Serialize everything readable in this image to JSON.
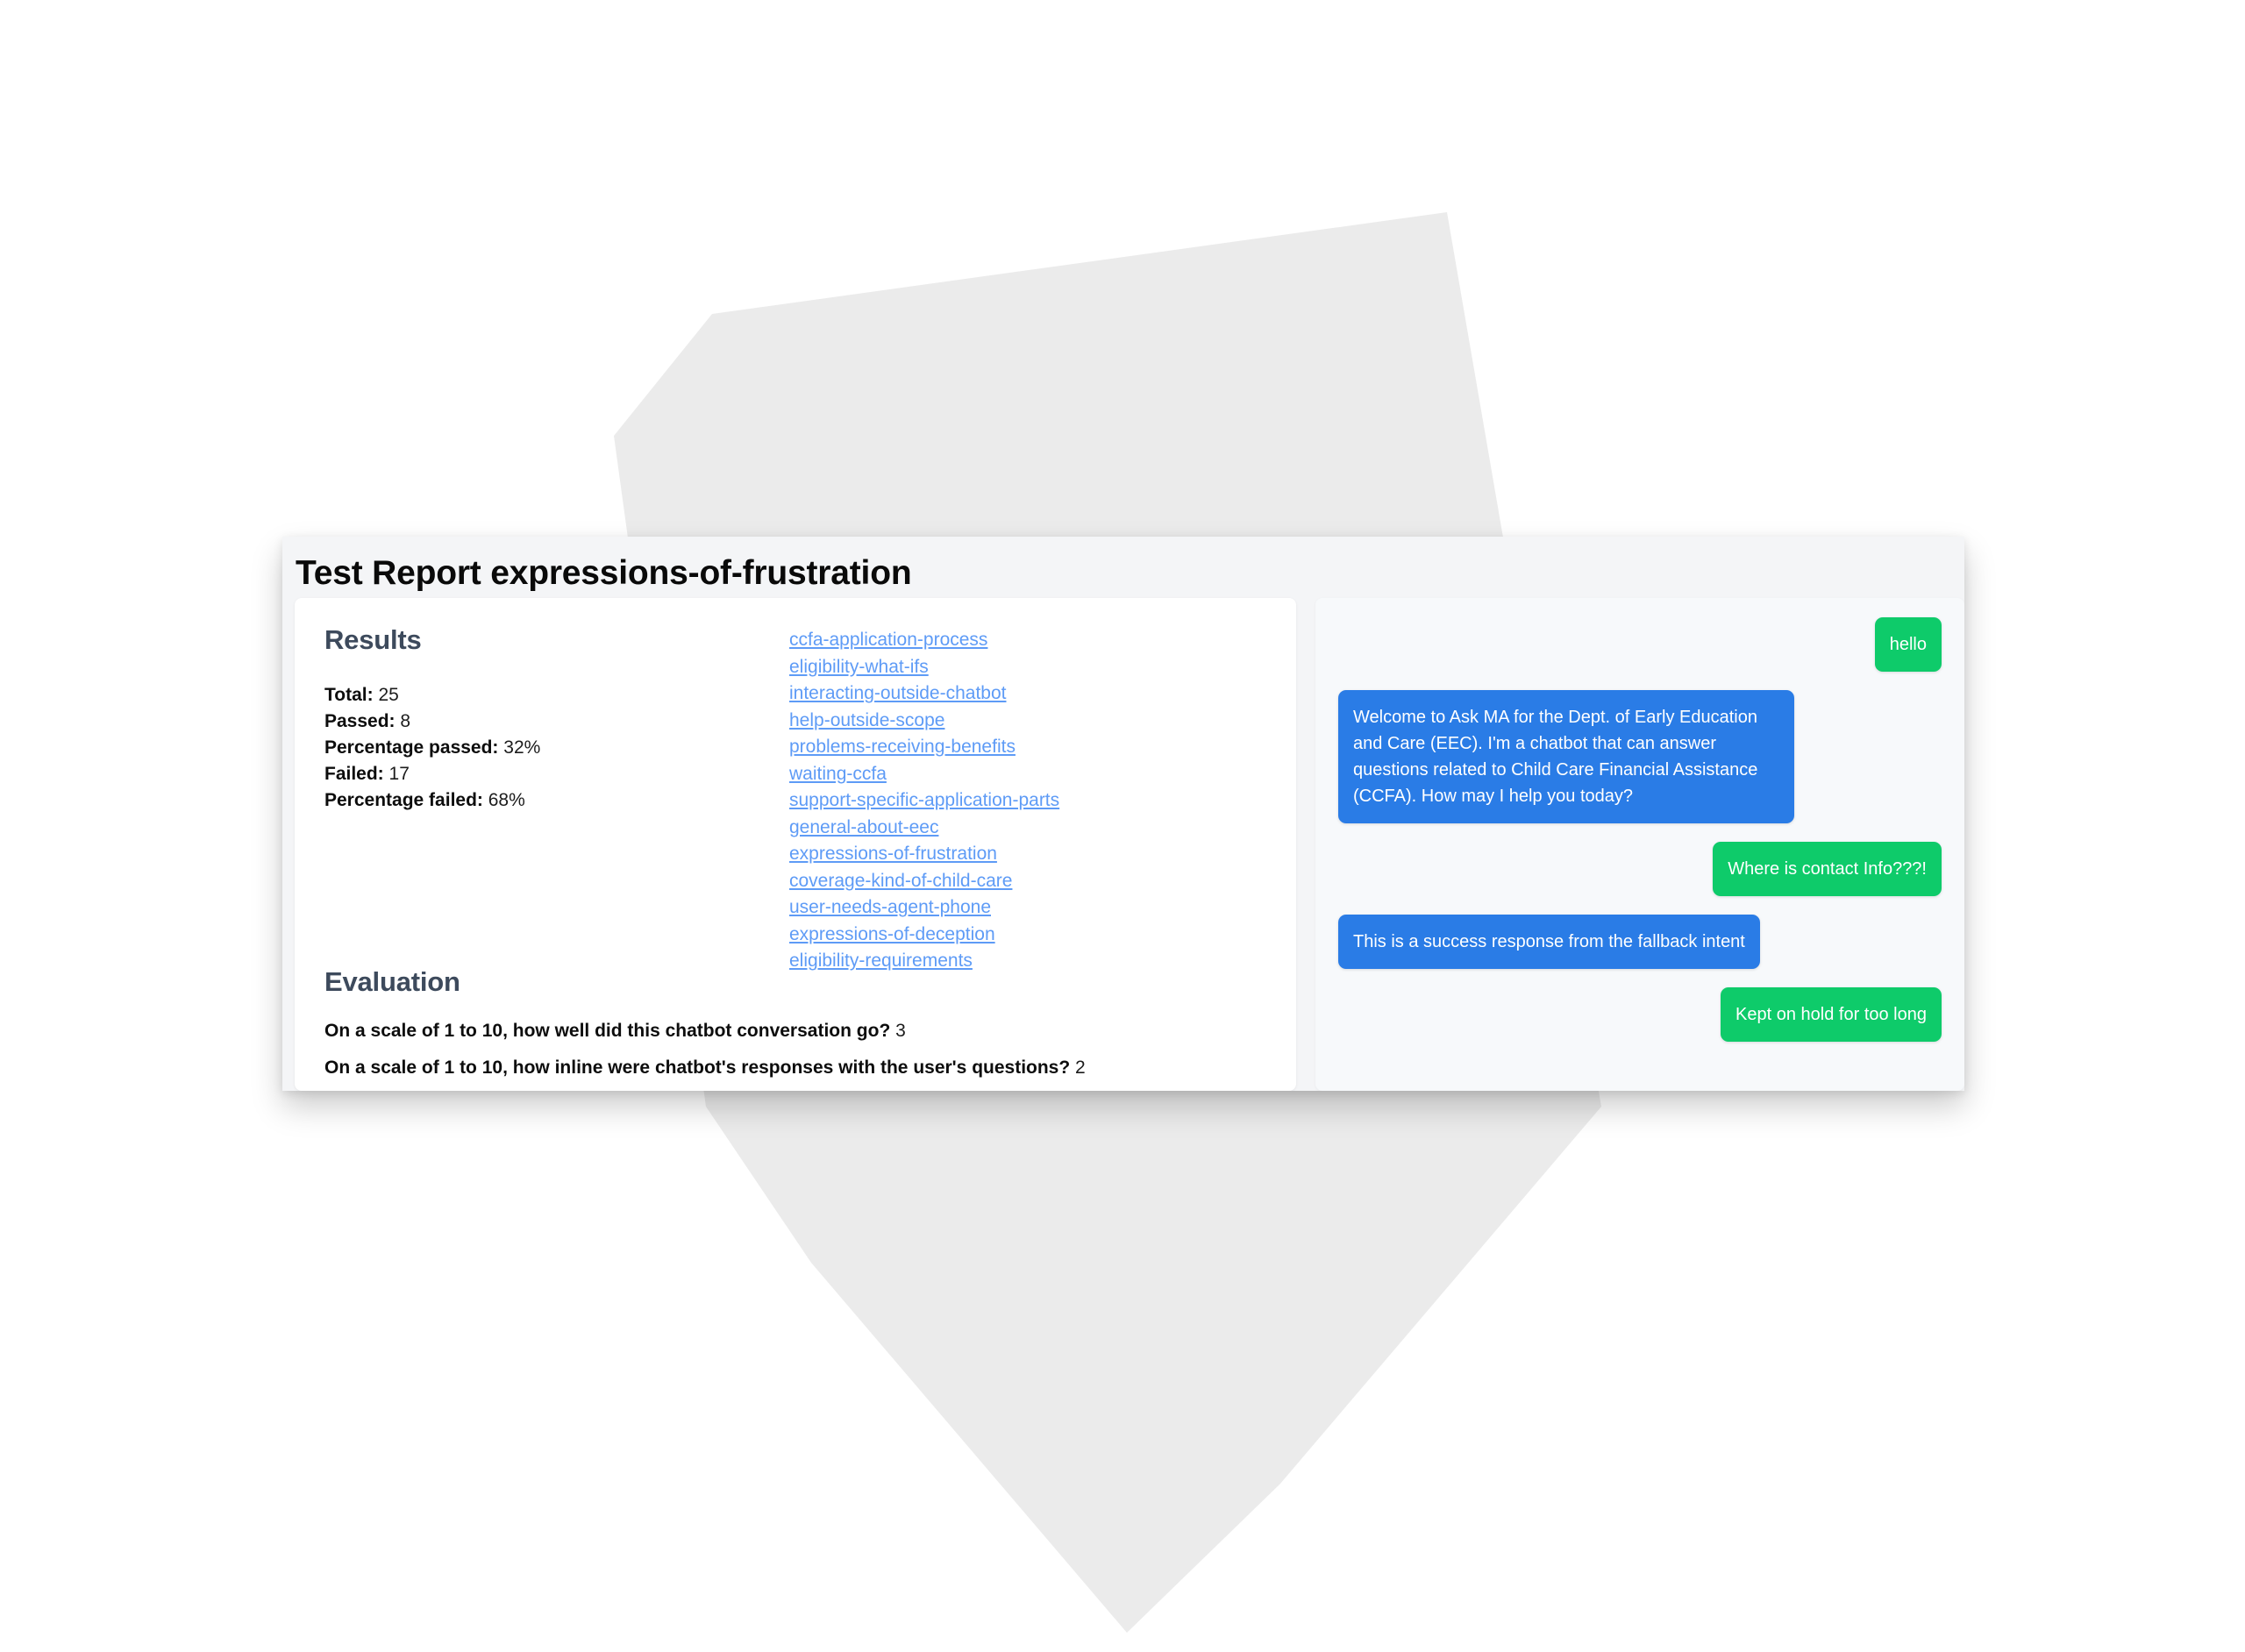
{
  "report": {
    "title": "Test Report expressions-of-frustration"
  },
  "results": {
    "heading": "Results",
    "stats": [
      {
        "label": "Total:",
        "value": "25"
      },
      {
        "label": "Passed:",
        "value": "8"
      },
      {
        "label": "Percentage passed:",
        "value": "32%"
      },
      {
        "label": "Failed:",
        "value": "17"
      },
      {
        "label": "Percentage failed:",
        "value": "68%"
      }
    ],
    "links": [
      "ccfa-application-process",
      "eligibility-what-ifs",
      "interacting-outside-chatbot",
      "help-outside-scope",
      "problems-receiving-benefits",
      "waiting-ccfa",
      "support-specific-application-parts",
      "general-about-eec",
      "expressions-of-frustration",
      "coverage-kind-of-child-care",
      "user-needs-agent-phone",
      "expressions-of-deception",
      "eligibility-requirements"
    ]
  },
  "evaluation": {
    "heading": "Evaluation",
    "items": [
      {
        "question": "On a scale of 1 to 10, how well did this chatbot conversation go?",
        "answer": "3"
      },
      {
        "question": "On a scale of 1 to 10, how inline were chatbot's responses with the user's questions?",
        "answer": "2"
      }
    ]
  },
  "chat": {
    "messages": [
      {
        "sender": "user",
        "text": "hello"
      },
      {
        "sender": "bot",
        "text": "Welcome to Ask MA for the Dept. of Early Education and Care (EEC). I'm a chatbot that can answer questions related to Child Care Financial Assistance (CCFA). How may I help you today?"
      },
      {
        "sender": "user",
        "text": "Where is contact Info???!"
      },
      {
        "sender": "bot",
        "text": "This is a success response from the fallback intent"
      },
      {
        "sender": "user",
        "text": "Kept on hold for too long"
      }
    ]
  },
  "colors": {
    "user_bubble": "#0ecb6a",
    "bot_bubble": "#2a7ce6",
    "link": "#5e9bf6",
    "heading": "#3d4a5c",
    "card_bg": "#f4f5f7",
    "chat_bg": "#f7f9fb",
    "backdrop_shape": "#ebebeb"
  }
}
